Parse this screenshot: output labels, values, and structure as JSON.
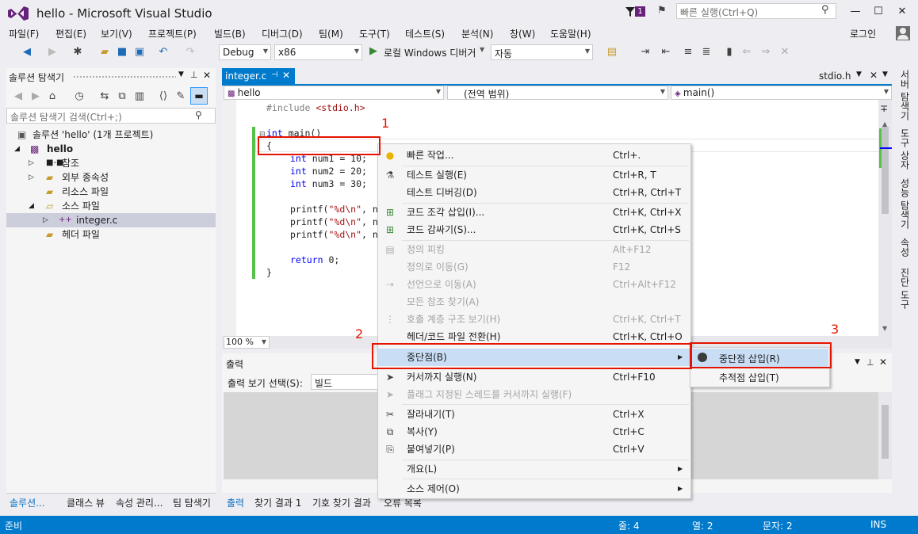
{
  "window": {
    "title": "hello - Microsoft Visual Studio",
    "notif_count": "1",
    "quick_launch_placeholder": "빠른 실행(Ctrl+Q)",
    "signin": "로그인"
  },
  "menu": [
    "파일(F)",
    "편집(E)",
    "보기(V)",
    "프로젝트(P)",
    "빌드(B)",
    "디버그(D)",
    "팀(M)",
    "도구(T)",
    "테스트(S)",
    "분석(N)",
    "창(W)",
    "도움말(H)"
  ],
  "toolbar": {
    "config": "Debug",
    "platform": "x86",
    "run_label": "로컬 Windows 디버거",
    "run_mode": "자동"
  },
  "solution_explorer": {
    "title": "솔루션 탐색기",
    "search_placeholder": "솔루션 탐색기 검색(Ctrl+;)",
    "items": [
      {
        "label": "솔루션 'hello' (1개 프로젝트)"
      },
      {
        "label": "hello"
      },
      {
        "label": "참조"
      },
      {
        "label": "외부 종속성"
      },
      {
        "label": "리소스 파일"
      },
      {
        "label": "소스 파일"
      },
      {
        "label": "integer.c"
      },
      {
        "label": "헤더 파일"
      }
    ],
    "bottom_tabs": [
      "솔루션...",
      "클래스 뷰",
      "속성 관리...",
      "팀 탐색기"
    ]
  },
  "editor": {
    "active_tab": "integer.c",
    "other_tab": "stdio.h",
    "nav_project": "hello",
    "nav_scope": "(전역 범위)",
    "nav_member": "main()",
    "zoom": "100 %",
    "lines": [
      "#include <stdio.h>",
      "",
      "int main()",
      "{",
      "    int num1 = 10;",
      "    int num2 = 20;",
      "    int num3 = 30;",
      "",
      "    printf(\"%d\\n\", n",
      "    printf(\"%d\\n\", n",
      "    printf(\"%d\\n\", n",
      "",
      "    return 0;",
      "}"
    ]
  },
  "output": {
    "title": "출력",
    "show_label": "출력 보기 선택(S):",
    "source": "빌드",
    "bottom_tabs": [
      "출력",
      "찾기 결과 1",
      "기호 찾기 결과",
      "오류 목록"
    ]
  },
  "context_menu": [
    {
      "label": "빠른 작업...",
      "shortcut": "Ctrl+.",
      "icon": "lightbulb-icon",
      "enabled": true
    },
    {
      "label": "테스트 실행(E)",
      "shortcut": "Ctrl+R, T",
      "icon": "flask-icon",
      "enabled": true
    },
    {
      "label": "테스트 디버깅(D)",
      "shortcut": "Ctrl+R, Ctrl+T",
      "icon": "",
      "enabled": true
    },
    {
      "label": "코드 조각 삽입(I)...",
      "shortcut": "Ctrl+K, Ctrl+X",
      "icon": "snippet-icon",
      "enabled": true
    },
    {
      "label": "코드 감싸기(S)...",
      "shortcut": "Ctrl+K, Ctrl+S",
      "icon": "surround-icon",
      "enabled": true
    },
    {
      "label": "정의 피킹",
      "shortcut": "Alt+F12",
      "icon": "peek-icon",
      "enabled": false
    },
    {
      "label": "정의로 이동(G)",
      "shortcut": "F12",
      "icon": "",
      "enabled": false
    },
    {
      "label": "선언으로 이동(A)",
      "shortcut": "Ctrl+Alt+F12",
      "icon": "goto-decl-icon",
      "enabled": false
    },
    {
      "label": "모든 참조 찾기(A)",
      "shortcut": "",
      "icon": "",
      "enabled": false
    },
    {
      "label": "호출 계층 구조 보기(H)",
      "shortcut": "Ctrl+K, Ctrl+T",
      "icon": "hierarchy-icon",
      "enabled": false
    },
    {
      "label": "헤더/코드 파일 전환(H)",
      "shortcut": "Ctrl+K, Ctrl+O",
      "icon": "",
      "enabled": true
    },
    {
      "label": "중단점(B)",
      "shortcut": "",
      "icon": "",
      "enabled": true,
      "submenu": true
    },
    {
      "label": "커서까지 실행(N)",
      "shortcut": "Ctrl+F10",
      "icon": "cursor-run-icon",
      "enabled": true
    },
    {
      "label": "플래그 지정된 스레드를 커서까지 실행(F)",
      "shortcut": "",
      "icon": "cursor-run-icon",
      "enabled": false
    },
    {
      "label": "잘라내기(T)",
      "shortcut": "Ctrl+X",
      "icon": "scissors-icon",
      "enabled": true
    },
    {
      "label": "복사(Y)",
      "shortcut": "Ctrl+C",
      "icon": "copy-icon",
      "enabled": true
    },
    {
      "label": "붙여넣기(P)",
      "shortcut": "Ctrl+V",
      "icon": "paste-icon",
      "enabled": true
    },
    {
      "label": "개요(L)",
      "shortcut": "",
      "icon": "",
      "enabled": true,
      "submenu": true
    },
    {
      "label": "소스 제어(O)",
      "shortcut": "",
      "icon": "",
      "enabled": true,
      "submenu": true
    }
  ],
  "submenu": [
    {
      "label": "중단점 삽입(R)"
    },
    {
      "label": "추적점 삽입(T)"
    }
  ],
  "callouts": [
    "1",
    "2",
    "3"
  ],
  "right_tabs": [
    "서버 탐색기",
    "도구 상자",
    "성능 탐색기",
    "속성",
    "진단 도구"
  ],
  "status": {
    "ready": "준비",
    "line": "줄: 4",
    "col": "열: 2",
    "char": "문자: 2",
    "mode": "INS"
  },
  "colors": {
    "accent": "#007acc",
    "highlight": "#c9def5",
    "callout": "#e51400"
  }
}
